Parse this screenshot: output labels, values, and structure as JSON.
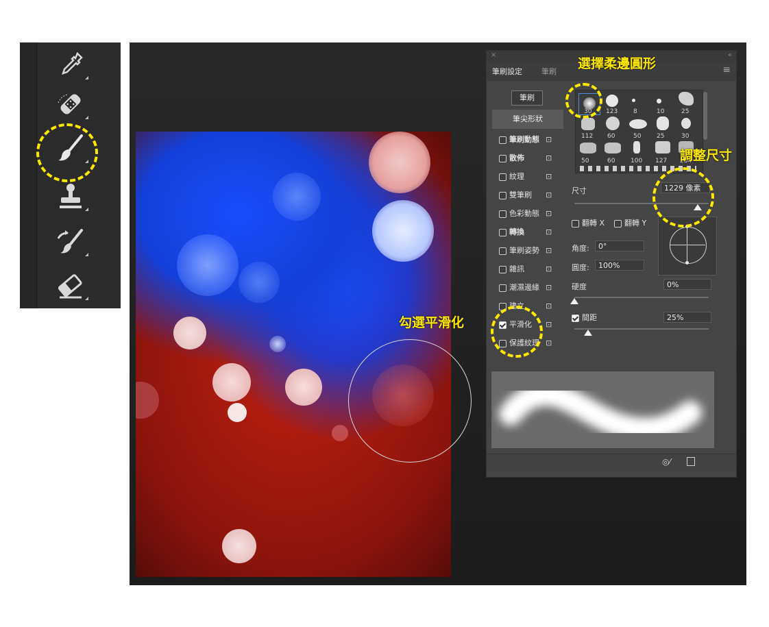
{
  "toolbar": {
    "tools": [
      "eyedropper-icon",
      "healing-brush-icon",
      "brush-icon",
      "clone-stamp-icon",
      "history-brush-icon",
      "eraser-icon"
    ]
  },
  "panel": {
    "close_glyph": "×",
    "collapse_glyph": "«",
    "menu_glyph": "≡",
    "tabs": [
      "筆刷設定",
      "筆刷"
    ],
    "brushes_button": "筆刷",
    "tip_shape": "筆尖形狀",
    "options": [
      {
        "label": "筆刷動態",
        "checked": false,
        "bold": true
      },
      {
        "label": "散佈",
        "checked": false,
        "bold": true
      },
      {
        "label": "紋理",
        "checked": false,
        "bold": false
      },
      {
        "label": "雙筆刷",
        "checked": false,
        "bold": false
      },
      {
        "label": "色彩動態",
        "checked": false,
        "bold": false
      },
      {
        "label": "轉換",
        "checked": false,
        "bold": true
      },
      {
        "label": "筆刷姿勢",
        "checked": false,
        "bold": false
      },
      {
        "label": "雜訊",
        "checked": false,
        "bold": false
      },
      {
        "label": "潮濕邊緣",
        "checked": false,
        "bold": false
      },
      {
        "label": "建立",
        "checked": false,
        "bold": false
      },
      {
        "label": "平滑化",
        "checked": true,
        "bold": false
      },
      {
        "label": "保護紋理",
        "checked": false,
        "bold": false
      }
    ],
    "lock_glyph": "🔓",
    "brush_sizes_row1": [
      "30",
      "123",
      "8",
      "10",
      "25"
    ],
    "brush_sizes_row2": [
      "112",
      "60",
      "50",
      "25",
      "30"
    ],
    "brush_sizes_row3": [
      "50",
      "60",
      "100",
      "127",
      "284"
    ],
    "size_label": "尺寸",
    "size_value": "1229 像素",
    "flip_x": "翻轉 X",
    "flip_y": "翻轉 Y",
    "angle_label": "角度:",
    "angle_value": "0°",
    "roundness_label": "圓度:",
    "roundness_value": "100%",
    "hardness_label": "硬度",
    "hardness_value": "0%",
    "spacing_label": "間距",
    "spacing_value": "25%",
    "spacing_checked": true,
    "footer_icons": [
      "eye-slash-icon",
      "new-preset-icon"
    ]
  },
  "annotations": {
    "choose_soft_round": "選擇柔邊圓形",
    "adjust_size": "調整尺寸",
    "check_smoothing": "勾選平滑化"
  },
  "colors": {
    "highlight": "#ffe800",
    "panel_bg": "#454545"
  }
}
